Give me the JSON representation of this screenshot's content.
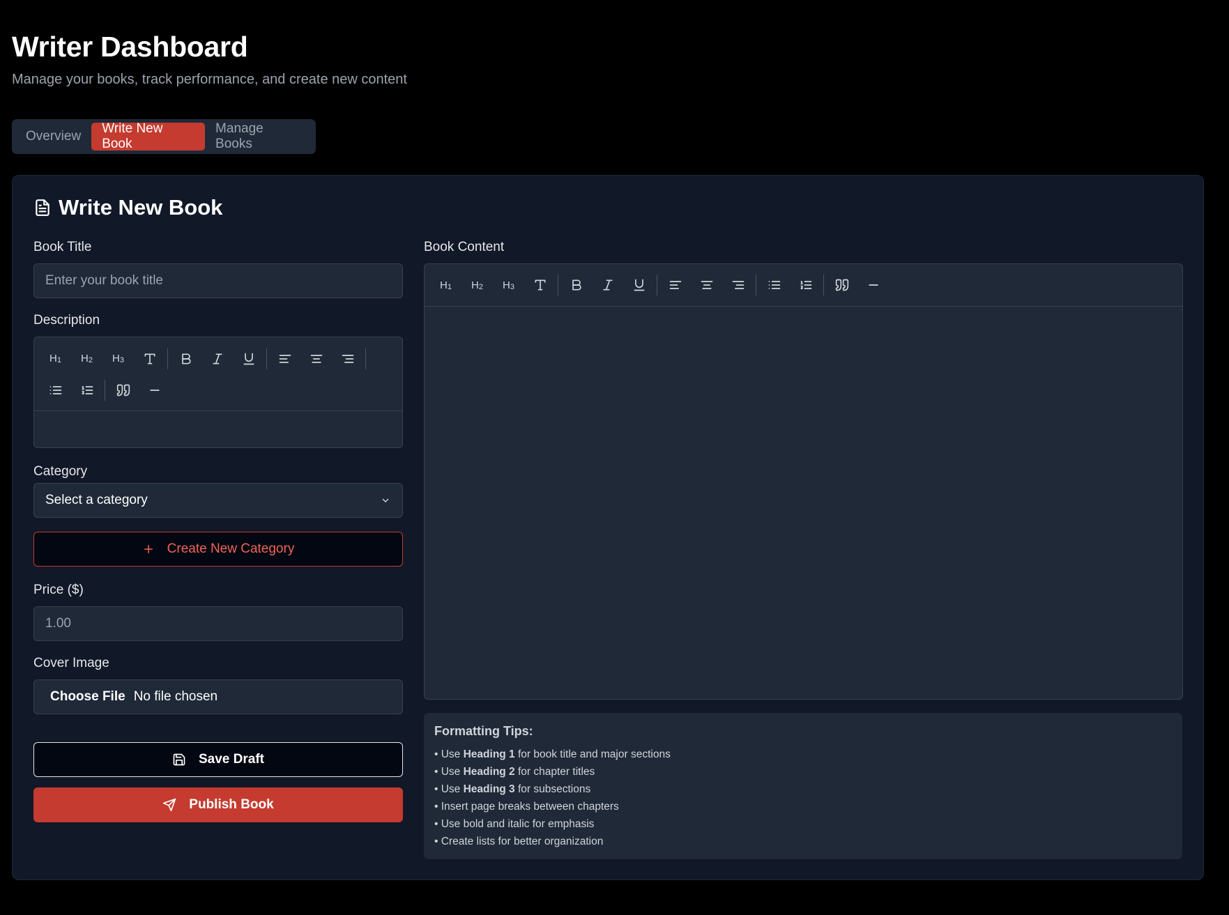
{
  "header": {
    "title": "Writer Dashboard",
    "subtitle": "Manage your books, track performance, and create new content"
  },
  "tabs": [
    {
      "label": "Overview",
      "active": false
    },
    {
      "label": "Write New Book",
      "active": true
    },
    {
      "label": "Manage Books",
      "active": false
    }
  ],
  "form": {
    "title": "Write New Book",
    "book_title_label": "Book Title",
    "book_title_placeholder": "Enter your book title",
    "description_label": "Description",
    "category_label": "Category",
    "category_selected": "Select a category",
    "create_category_label": "Create New Category",
    "price_label": "Price ($)",
    "price_placeholder": "1.00",
    "cover_label": "Cover Image",
    "choose_file_label": "Choose File",
    "no_file_label": "No file chosen",
    "save_draft_label": "Save Draft",
    "publish_label": "Publish Book",
    "content_label": "Book Content"
  },
  "toolbar": {
    "h1": "H",
    "h1_sub": "1",
    "h2": "H",
    "h2_sub": "2",
    "h3": "H",
    "h3_sub": "3"
  },
  "tips": {
    "title": "Formatting Tips:",
    "items": [
      {
        "pre": "• Use ",
        "bold": "Heading 1",
        "post": " for book title and major sections"
      },
      {
        "pre": "• Use ",
        "bold": "Heading 2",
        "post": " for chapter titles"
      },
      {
        "pre": "• Use ",
        "bold": "Heading 3",
        "post": " for subsections"
      },
      {
        "pre": "• Insert page breaks between chapters",
        "bold": "",
        "post": ""
      },
      {
        "pre": "• Use bold and italic for emphasis",
        "bold": "",
        "post": ""
      },
      {
        "pre": "• Create lists for better organization",
        "bold": "",
        "post": ""
      }
    ]
  },
  "colors": {
    "accent": "#c53b30",
    "background": "#000000",
    "card": "#111827",
    "input": "#1f2937"
  }
}
